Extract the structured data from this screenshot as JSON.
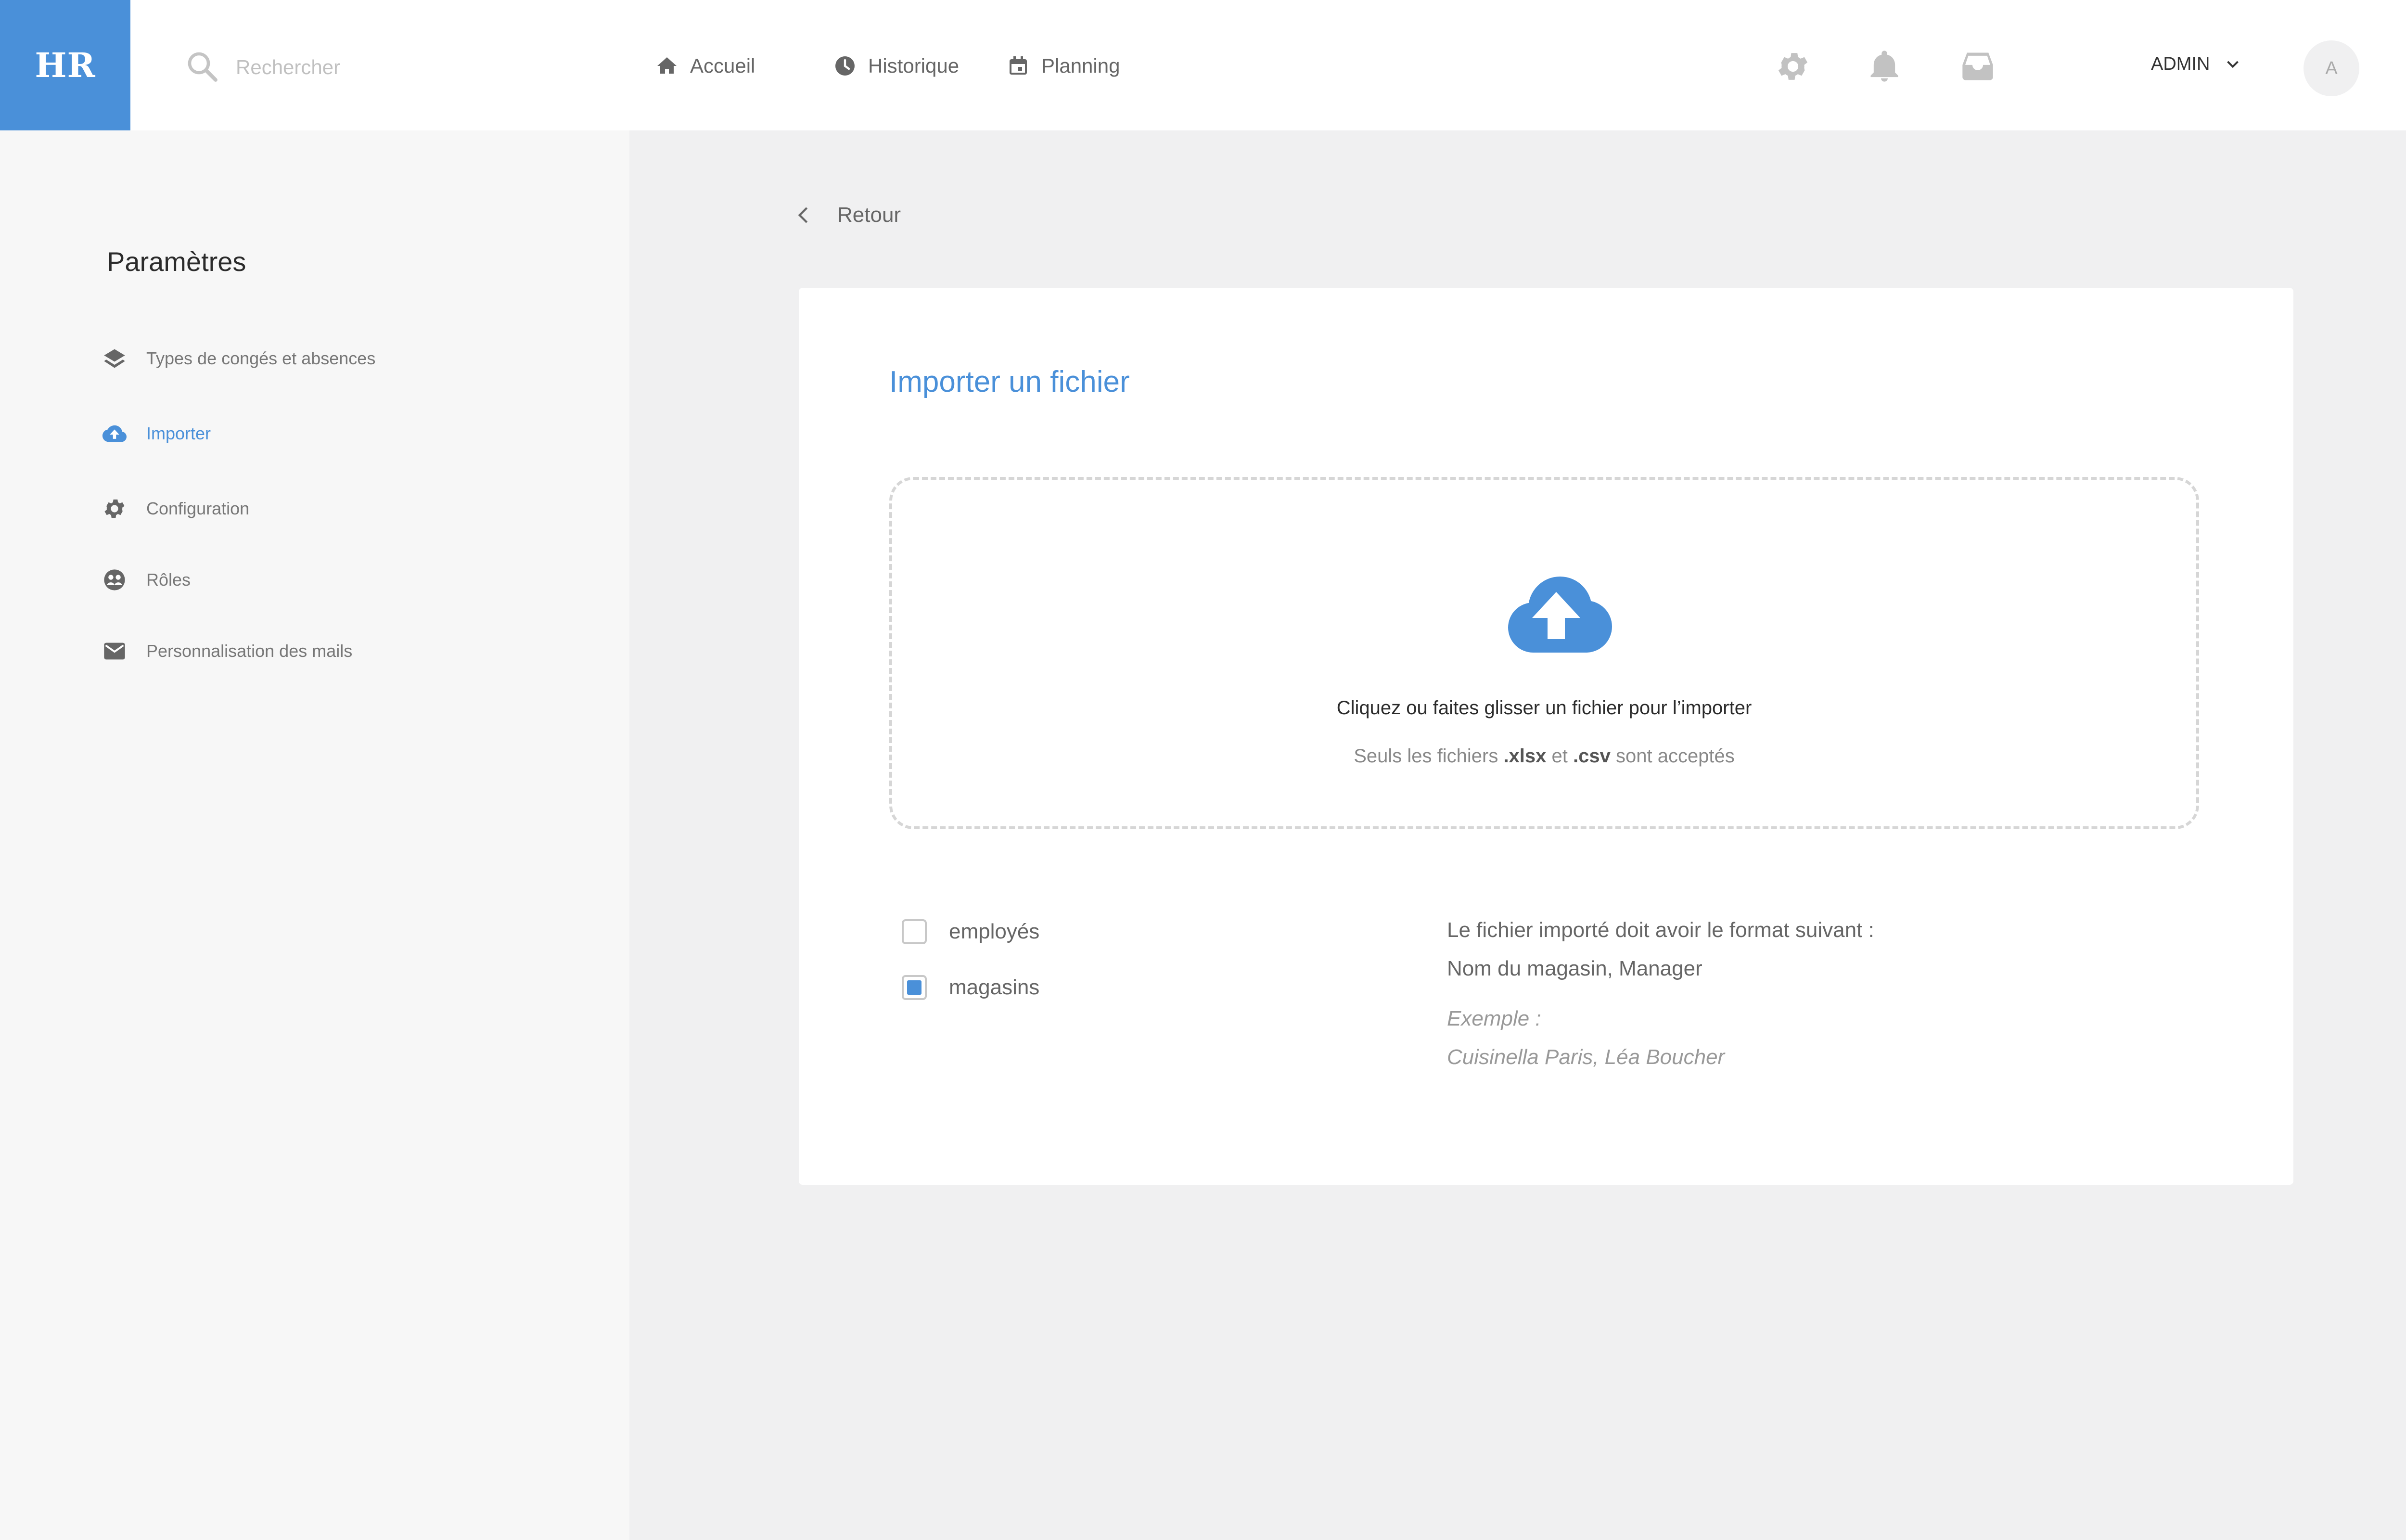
{
  "app": {
    "logo": "HR"
  },
  "header": {
    "search_placeholder": "Rechercher",
    "nav": [
      {
        "label": "Accueil",
        "icon": "home-icon"
      },
      {
        "label": "Historique",
        "icon": "clock-icon"
      },
      {
        "label": "Planning",
        "icon": "calendar-icon"
      }
    ],
    "icons": [
      "gear-icon",
      "bell-icon",
      "inbox-icon"
    ],
    "user_label": "ADMIN",
    "avatar_initial": "A"
  },
  "sidebar": {
    "title": "Paramètres",
    "items": [
      {
        "label": "Types de congés et absences",
        "icon": "layers-icon",
        "active": false
      },
      {
        "label": "Importer",
        "icon": "cloud-upload-icon",
        "active": true
      },
      {
        "label": "Configuration",
        "icon": "gear-icon",
        "active": false
      },
      {
        "label": "Rôles",
        "icon": "roles-icon",
        "active": false
      },
      {
        "label": "Personnalisation des mails",
        "icon": "mail-icon",
        "active": false
      }
    ]
  },
  "main": {
    "back_label": "Retour",
    "card": {
      "title": "Importer un fichier",
      "dropzone": {
        "text": "Cliquez ou faites glisser un fichier pour l’importer",
        "sub_prefix": "Seuls les fichiers ",
        "sub_ext1": ".xlsx",
        "sub_mid": " et ",
        "sub_ext2": ".csv",
        "sub_suffix": " sont acceptés"
      },
      "options": [
        {
          "label": "employés",
          "checked": false
        },
        {
          "label": "magasins",
          "checked": true
        }
      ],
      "format_title": "Le fichier importé doit avoir le format suivant :",
      "format_value": "Nom du magasin, Manager",
      "example_label": "Exemple :",
      "example_value": "Cuisinella Paris, Léa Boucher"
    }
  },
  "colors": {
    "accent": "#4a90d9",
    "background": "#f0f0f1",
    "sidebar": "#f7f7f7"
  }
}
